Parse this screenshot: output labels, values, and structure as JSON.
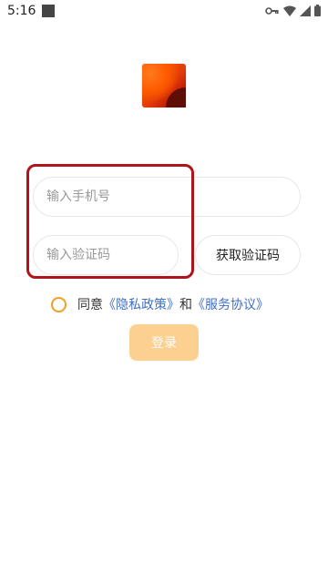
{
  "status_bar": {
    "time": "5:16",
    "icons": [
      "notification-square-icon",
      "key-icon",
      "wifi-icon",
      "signal-icon",
      "battery-icon"
    ]
  },
  "logo": {
    "icon": "app-logo"
  },
  "phone_input": {
    "placeholder": "输入手机号",
    "value": ""
  },
  "code_input": {
    "placeholder": "输入验证码",
    "value": ""
  },
  "get_code_button": {
    "label": "获取验证码"
  },
  "agreement": {
    "prefix": "同意",
    "privacy_link": "《隐私政策》",
    "and": "和",
    "service_link": "《服务协议》"
  },
  "login_button": {
    "label": "登录"
  },
  "colors": {
    "accent": "#f0a020",
    "login_disabled": "#fbd090",
    "link": "#3f6fc6",
    "highlight": "#b0141a"
  }
}
